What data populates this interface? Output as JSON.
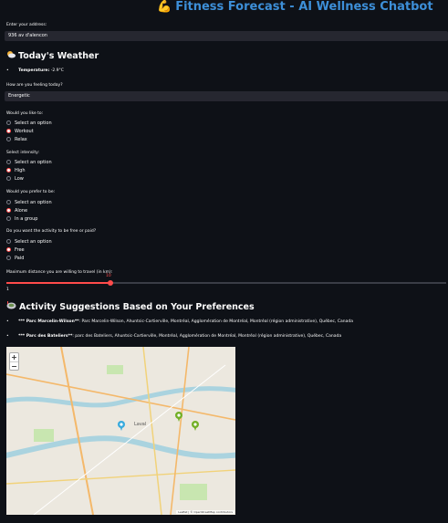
{
  "header": {
    "title_emoji": "💪",
    "title": "Fitness Forecast - AI Wellness Chatbot"
  },
  "address": {
    "label": "Enter your address:",
    "value": "936 av d'alencon"
  },
  "weather": {
    "heading_icon": "sun-behind-cloud-icon",
    "heading": "Today's Weather",
    "temperature_label": "Temperature:",
    "temperature_value": "-2.9°C"
  },
  "feeling": {
    "label": "How are you feeling today?",
    "value": "Energetic"
  },
  "activity_type": {
    "label": "Would you like to:",
    "options": [
      "Select an option",
      "Workout",
      "Relax"
    ],
    "selected": "Workout"
  },
  "intensity": {
    "label": "Select intensity:",
    "options": [
      "Select an option",
      "High",
      "Low"
    ],
    "selected": "High"
  },
  "company": {
    "label": "Would you prefer to be:",
    "options": [
      "Select an option",
      "Alone",
      "In a group"
    ],
    "selected": "Alone"
  },
  "cost": {
    "label": "Do you want the activity to be free or paid?",
    "options": [
      "Select an option",
      "Free",
      "Paid"
    ],
    "selected": "Free"
  },
  "distance": {
    "label": "Maximum distance you are willing to travel (in km):",
    "value": "10",
    "min": "1",
    "max_fraction": 0.24
  },
  "suggestions": {
    "heading_icon": "stadium-icon",
    "heading": "Activity Suggestions Based on Your Preferences",
    "items": [
      {
        "name": "*** Parc Marcelin-Wilson**",
        "detail": ": Parc Marcelin-Wilson, Ahuntsic-Cartierville, Montréal, Agglomération de Montréal, Montréal (région administrative), Québec, Canada"
      },
      {
        "name": "*** Parc des Bateliers**",
        "detail": ": parc des Bateliers, Ahuntsic-Cartierville, Montréal, Agglomération de Montréal, Montréal (région administrative), Québec, Canada"
      }
    ]
  },
  "map": {
    "zoom_in": "+",
    "zoom_out": "−",
    "place_label": "Laval",
    "attribution": "Leaflet | © OpenStreetMap contributors",
    "colors": {
      "user_marker": "#38aadd",
      "park_marker": "#72af26",
      "water": "#aad3df",
      "park": "#c8e6b0"
    }
  }
}
